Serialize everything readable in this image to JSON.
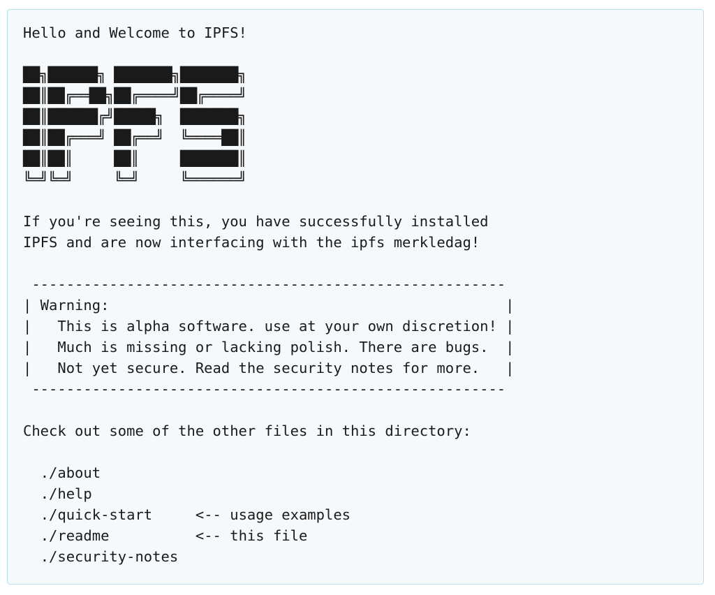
{
  "readme": {
    "greeting": "Hello and Welcome to IPFS!",
    "banner_lines": [
      "██╗██████╗ ███████╗███████╗",
      "██║██╔══██╗██╔════╝██╔════╝",
      "██║██████╔╝█████╗  ███████╗",
      "██║██╔═══╝ ██╔══╝  ╚════██║",
      "██║██║     ██║     ███████║",
      "╚═╝╚═╝     ╚═╝     ╚══════╝"
    ],
    "intro_line_1": "If you're seeing this, you have successfully installed",
    "intro_line_2": "IPFS and are now interfacing with the ipfs merkledag!",
    "warning_box": {
      "top_border": " -------------------------------------------------------",
      "line_1": "| Warning:                                              |",
      "line_2": "|   This is alpha software. use at your own discretion! |",
      "line_3": "|   Much is missing or lacking polish. There are bugs.  |",
      "line_4": "|   Not yet secure. Read the security notes for more.   |",
      "bottom_border": " -------------------------------------------------------"
    },
    "files_heading": "Check out some of the other files in this directory:",
    "files": [
      {
        "path": "./about",
        "note": ""
      },
      {
        "path": "./help",
        "note": ""
      },
      {
        "path": "./quick-start",
        "note": "<-- usage examples"
      },
      {
        "path": "./readme",
        "note": "<-- this file"
      },
      {
        "path": "./security-notes",
        "note": ""
      }
    ]
  }
}
